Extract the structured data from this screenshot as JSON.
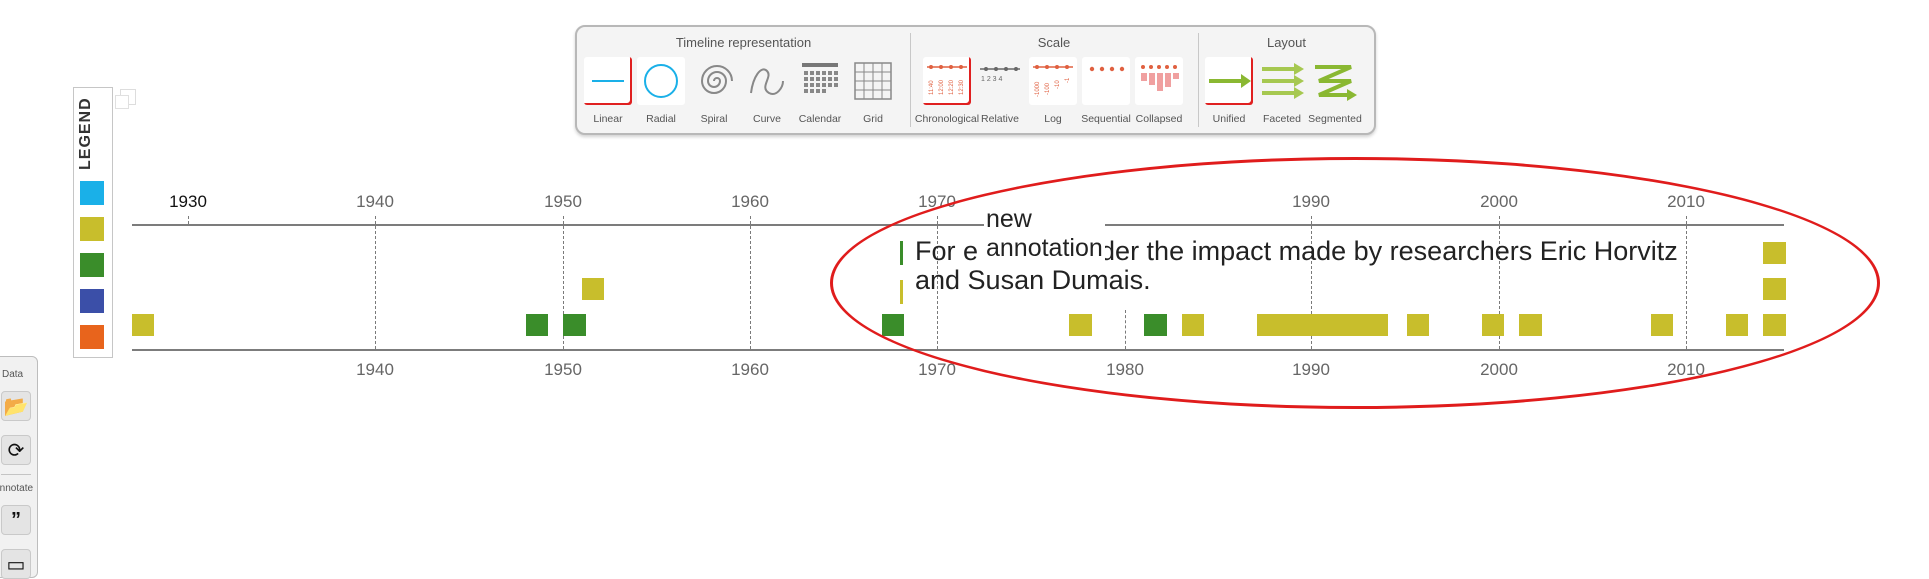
{
  "toolbar": {
    "groups": [
      {
        "title": "Timeline representation",
        "items": [
          "Linear",
          "Radial",
          "Spiral",
          "Curve",
          "Calendar",
          "Grid"
        ],
        "active": "Linear"
      },
      {
        "title": "Scale",
        "items": [
          "Chronological",
          "Relative",
          "Log",
          "Sequential",
          "Collapsed"
        ],
        "active": "Chronological"
      },
      {
        "title": "Layout",
        "items": [
          "Unified",
          "Faceted",
          "Segmented"
        ],
        "active": "Unified"
      }
    ],
    "relative_icon_digits": "1 2 3 4",
    "log_icon_digits": [
      "-1000",
      "-100",
      "-10",
      "-1"
    ],
    "chronological_icon_digits": [
      "11:40",
      "12:00",
      "12:20",
      "12:30"
    ]
  },
  "legend": {
    "title": "LEGEND",
    "colors": [
      "#1ab0e8",
      "#c8be2c",
      "#3a8d2a",
      "#3b4fa8",
      "#e8641c"
    ]
  },
  "timeline": {
    "top_ticks": [
      "1930",
      "1940",
      "1950",
      "1960",
      "1970",
      "1990",
      "2000",
      "2010"
    ],
    "bottom_ticks": [
      "1940",
      "1950",
      "1960",
      "1970",
      "1980",
      "1990",
      "2000",
      "2010"
    ],
    "year_range": [
      1927,
      2015
    ],
    "colors": {
      "yellow": "#c8be2c",
      "green": "#3a8d2a"
    },
    "events": [
      {
        "start": 1927.0,
        "end": 1928.2,
        "row": 0,
        "color": "yellow"
      },
      {
        "start": 1948.0,
        "end": 1949.2,
        "row": 0,
        "color": "green"
      },
      {
        "start": 1950.0,
        "end": 1951.2,
        "row": 0,
        "color": "green"
      },
      {
        "start": 1951.0,
        "end": 1952.2,
        "row": 1,
        "color": "yellow"
      },
      {
        "start": 1967.0,
        "end": 1968.2,
        "row": 0,
        "color": "green"
      },
      {
        "start": 1977.0,
        "end": 1978.2,
        "row": 0,
        "color": "yellow"
      },
      {
        "start": 1981.0,
        "end": 1982.2,
        "row": 0,
        "color": "green"
      },
      {
        "start": 1983.0,
        "end": 1984.2,
        "row": 0,
        "color": "yellow"
      },
      {
        "start": 1987.0,
        "end": 1994.0,
        "row": 0,
        "color": "yellow"
      },
      {
        "start": 1995.0,
        "end": 1996.2,
        "row": 0,
        "color": "yellow"
      },
      {
        "start": 1999.0,
        "end": 2000.2,
        "row": 0,
        "color": "yellow"
      },
      {
        "start": 2001.0,
        "end": 2002.2,
        "row": 0,
        "color": "yellow"
      },
      {
        "start": 2008.0,
        "end": 2009.2,
        "row": 0,
        "color": "yellow"
      },
      {
        "start": 2012.0,
        "end": 2013.2,
        "row": 0,
        "color": "yellow"
      },
      {
        "start": 2014.0,
        "end": 2015.2,
        "row": 0,
        "color": "yellow"
      },
      {
        "start": 2014.0,
        "end": 2015.2,
        "row": 1,
        "color": "yellow"
      },
      {
        "start": 2014.0,
        "end": 2015.2,
        "row": 2,
        "color": "yellow"
      }
    ]
  },
  "annotation": {
    "line1_prefix": "For e",
    "line1_suffix": "der the impact made by researchers Eric Horvitz",
    "line2": "and Susan Dumais.",
    "new_label": "new\nannotation"
  },
  "side_panel": {
    "data_label": "Data",
    "annotate_label": "Annotate",
    "buttons": [
      "open-folder-icon",
      "refresh-icon",
      "quote-icon",
      "note-icon"
    ]
  }
}
